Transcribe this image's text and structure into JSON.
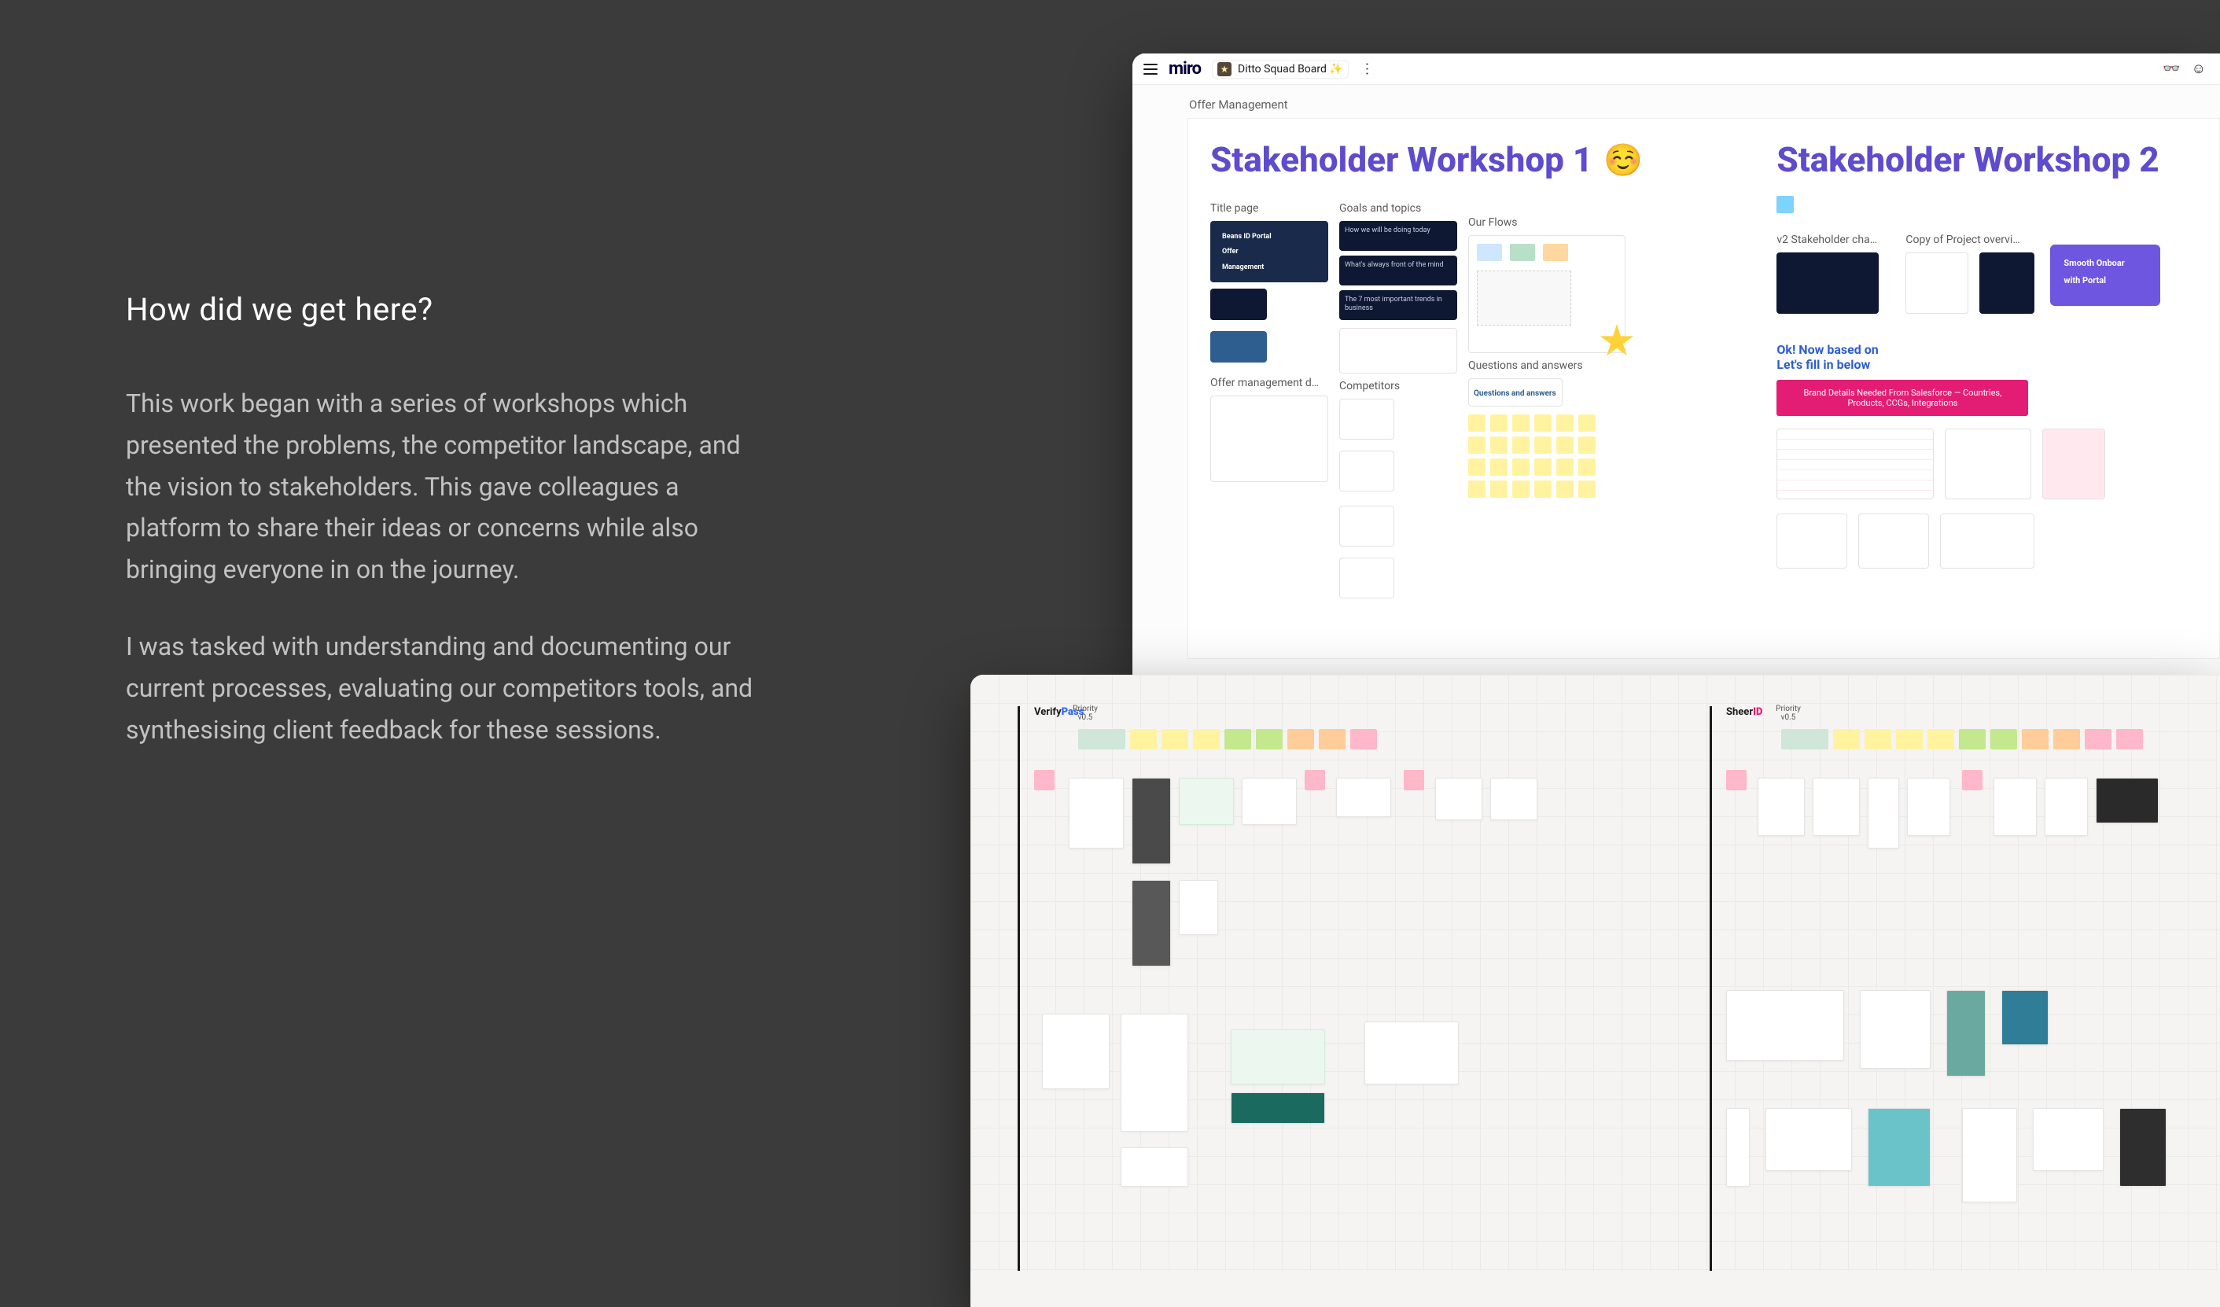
{
  "narrative": {
    "heading": "How did we get here?",
    "p1": "This work began with a series of workshops which presented the problems, the competitor landscape, and the vision to stakeholders. This gave colleagues a platform to share their ideas or concerns while also bringing everyone in on the journey.",
    "p2": "I was tasked with understanding and documenting our current processes, evaluating our competitors tools, and synthesising client feedback for these sessions."
  },
  "miro": {
    "logo": "miro",
    "board_name": "Ditto Squad Board ✨",
    "frame_label": "Offer Management",
    "topbar_icons": {
      "glasses": "👓",
      "reactions": "☺"
    },
    "workshop1": {
      "title": "Stakeholder Workshop 1",
      "emoji": "☺️",
      "sections": {
        "title_page": "Title page",
        "goals": "Goals and topics",
        "offermgmt": "Offer management d…",
        "flows": "Our Flows",
        "competitors": "Competitors",
        "q_and_a": "Questions and answers",
        "qa_card": "Questions and answers"
      },
      "slides": {
        "hero_line1": "Beans ID Portal",
        "hero_line2": "Offer",
        "hero_line3": "Management",
        "goal1": "How we will be doing today",
        "goal2": "What's always front of the mind",
        "goal3": "The 7 most important trends in business"
      }
    },
    "workshop2": {
      "title": "Stakeholder Workshop 2",
      "sections": {
        "chart": "v2 Stakeholder cha…",
        "overview": "Copy of Project overvi…"
      },
      "purple_card_line1": "Smooth Onboar",
      "purple_card_line2": "with Portal",
      "pink_bar": "Brand Details Needed From Salesforce — Countries, Products, CCGs, Integrations",
      "now_based": "Ok! Now based on",
      "fill_below": "Let's fill in below"
    }
  },
  "second_board": {
    "lane1_brand": "VerifyPass",
    "lane2_brand": "SheerID",
    "priority_label": "Priority v0.5"
  }
}
